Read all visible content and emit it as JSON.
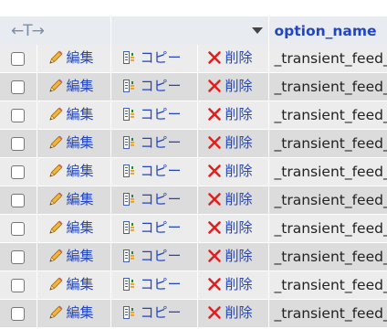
{
  "header": {
    "sort_arrows": "←T→",
    "column_name": "option_name"
  },
  "actions": {
    "edit_label": "編集",
    "copy_label": "コピー",
    "delete_label": "削除"
  },
  "colors": {
    "link": "#2245c2",
    "header_bg": "#e8ecf1",
    "row_light": "#ececec",
    "row_dark": "#dcdcdc",
    "delete_icon": "#e02020"
  },
  "rows": [
    {
      "option_name": "_transient_feed_"
    },
    {
      "option_name": "_transient_feed_"
    },
    {
      "option_name": "_transient_feed_"
    },
    {
      "option_name": "_transient_feed_"
    },
    {
      "option_name": "_transient_feed_"
    },
    {
      "option_name": "_transient_feed_"
    },
    {
      "option_name": "_transient_feed_"
    },
    {
      "option_name": "_transient_feed_"
    },
    {
      "option_name": "_transient_feed_"
    },
    {
      "option_name": "_transient_feed_"
    }
  ]
}
